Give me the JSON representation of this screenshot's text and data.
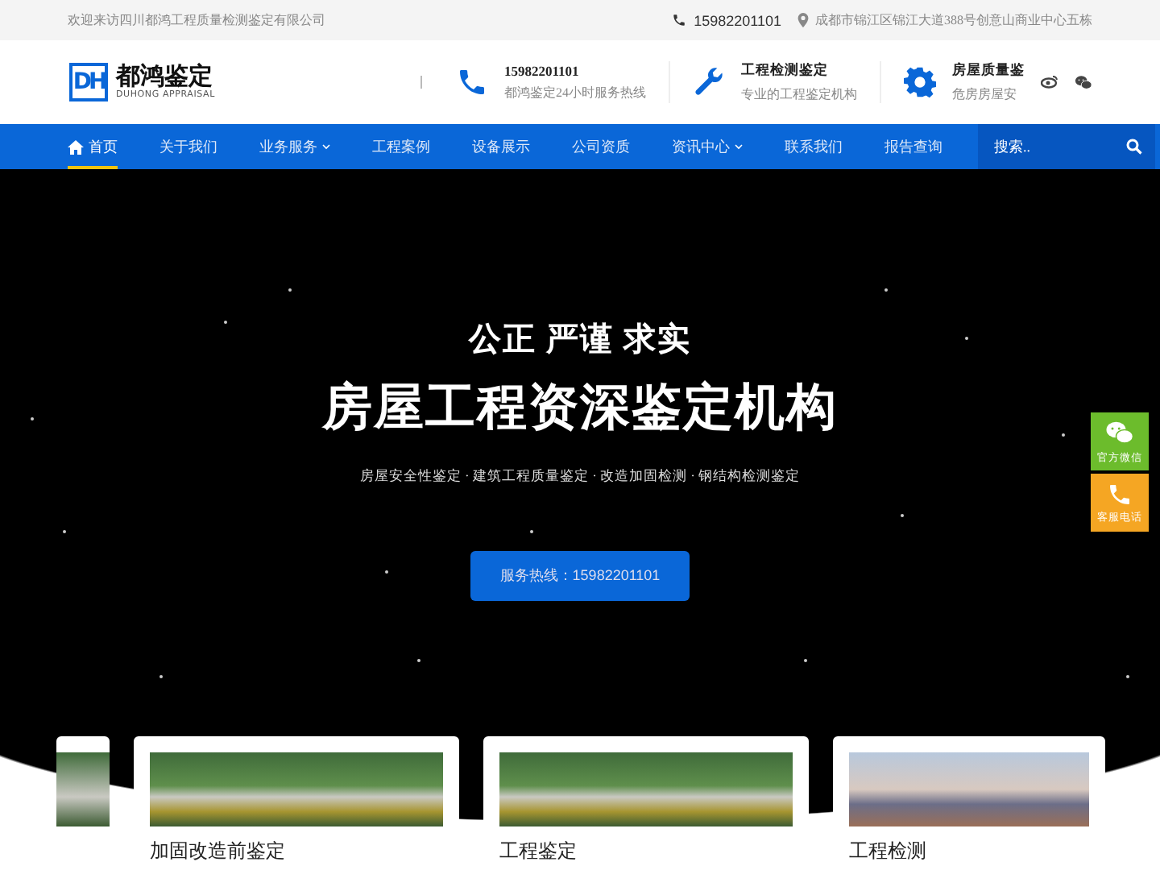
{
  "top_bar": {
    "welcome": "欢迎来访四川都鸿工程质量检测鉴定有限公司",
    "phone": "15982201101",
    "address": "成都市锦江区锦江大道388号创意山商业中心五栋"
  },
  "header": {
    "logo": {
      "mark": "DH",
      "name": "都鸿鉴定",
      "subtitle": "DUHONG APPRAISAL"
    },
    "contacts": [
      {
        "kind": "phone",
        "title": "15982201101",
        "subtitle": "都鸿鉴定24小时服务热线"
      },
      {
        "kind": "wrench",
        "title": "工程检测鉴定",
        "subtitle": "专业的工程鉴定机构"
      },
      {
        "kind": "gear",
        "title": "房屋质量鉴",
        "subtitle": "危房房屋安"
      }
    ]
  },
  "nav": {
    "items": [
      {
        "label": "首页",
        "selected": true,
        "home_icon": true,
        "has_dropdown": false
      },
      {
        "label": "关于我们",
        "selected": false,
        "home_icon": false,
        "has_dropdown": false
      },
      {
        "label": "业务服务",
        "selected": false,
        "home_icon": false,
        "has_dropdown": true
      },
      {
        "label": "工程案例",
        "selected": false,
        "home_icon": false,
        "has_dropdown": false
      },
      {
        "label": "设备展示",
        "selected": false,
        "home_icon": false,
        "has_dropdown": false
      },
      {
        "label": "公司资质",
        "selected": false,
        "home_icon": false,
        "has_dropdown": false
      },
      {
        "label": "资讯中心",
        "selected": false,
        "home_icon": false,
        "has_dropdown": true
      },
      {
        "label": "联系我们",
        "selected": false,
        "home_icon": false,
        "has_dropdown": false
      },
      {
        "label": "报告查询",
        "selected": false,
        "home_icon": false,
        "has_dropdown": false
      }
    ],
    "search": {
      "placeholder": "搜索.."
    }
  },
  "hero": {
    "tagline": "公正 严谨 求实",
    "title": "房屋工程资深鉴定机构",
    "services": "房屋安全性鉴定 · 建筑工程质量鉴定 · 改造加固检测 · 钢结构检测鉴定",
    "button": "服务热线：15982201101"
  },
  "float_buttons": [
    {
      "kind": "wechat",
      "label": "官方微信",
      "color": "#6cbc2c"
    },
    {
      "kind": "phone",
      "label": "客服电话",
      "color": "#f5a623"
    }
  ],
  "cards": [
    {
      "kind": "bridge",
      "title": "加固改造前鉴定"
    },
    {
      "kind": "bridge",
      "title": "工程鉴定"
    },
    {
      "kind": "city",
      "title": "工程检测"
    }
  ]
}
